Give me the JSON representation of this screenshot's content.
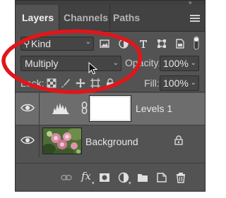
{
  "tabs": [
    {
      "label": "Layers",
      "active": true
    },
    {
      "label": "Channels",
      "active": false
    },
    {
      "label": "Paths",
      "active": false
    }
  ],
  "filter": {
    "kind_label": "Kind",
    "icons": [
      "image-filter-icon",
      "adjustment-filter-icon",
      "type-filter-icon",
      "shape-filter-icon",
      "smart-object-filter-icon",
      "filter-toggle-icon"
    ]
  },
  "blend": {
    "mode": "Multiply",
    "opacity_label": "Opacity:",
    "opacity_value": "100%"
  },
  "lock": {
    "label": "Lock:",
    "icons": [
      "lock-transparent-pixels-icon",
      "lock-image-pixels-icon",
      "lock-position-icon",
      "lock-artboard-icon",
      "lock-all-icon"
    ],
    "fill_label": "Fill:",
    "fill_value": "100%"
  },
  "layers": [
    {
      "name": "Levels 1",
      "type": "adjustment",
      "visible": true,
      "selected": true
    },
    {
      "name": "Background",
      "type": "image",
      "visible": true,
      "selected": false,
      "locked": true
    }
  ],
  "footer_icons": [
    "link-layers-icon",
    "fx-icon",
    "add-mask-icon",
    "adjustment-layer-icon",
    "new-group-icon",
    "new-layer-icon",
    "trash-icon"
  ],
  "colors": {
    "panel_bg": "#535353",
    "selected_row": "#6d6d6d",
    "annotation": "#e0161b"
  }
}
